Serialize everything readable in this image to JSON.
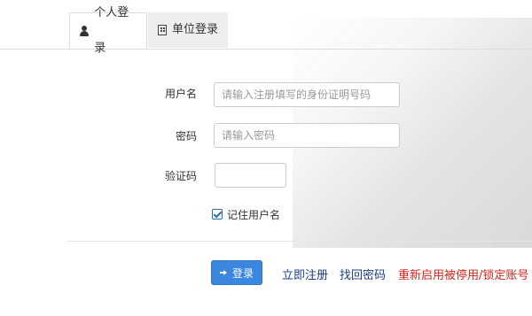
{
  "tabs": {
    "personal": {
      "label": "个人登录",
      "icon": "user-icon"
    },
    "unit": {
      "label": "单位登录",
      "icon": "building-icon"
    }
  },
  "form": {
    "username_label": "用户名",
    "username_placeholder": "请输入注册填写的身份证明号码",
    "password_label": "密码",
    "password_placeholder": "请输入密码",
    "captcha_label": "验证码",
    "remember_label": "记住用户名",
    "remember_checked": true
  },
  "actions": {
    "login_label": "登录",
    "register_label": "立即注册",
    "recover_label": "找回密码",
    "reactivate_label": "重新启用被停用/锁定账号"
  },
  "colors": {
    "primary": "#3b86e0",
    "link": "#1a3e8c",
    "danger": "#e0231b"
  }
}
